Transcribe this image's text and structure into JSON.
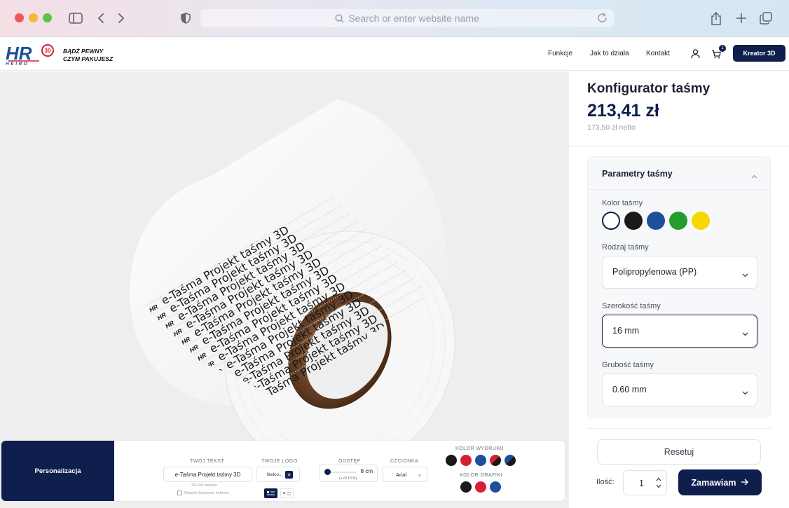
{
  "browser": {
    "address_placeholder": "Search or enter website name"
  },
  "header": {
    "brand": "HR",
    "brand_sub": "HEIRO",
    "brand_badge": "30",
    "tagline_1": "BĄDŹ PEWNY",
    "tagline_2": "CZYM PAKUJESZ",
    "nav": [
      "Funkcje",
      "Jak to działa",
      "Kontakt"
    ],
    "cart_count": "1",
    "cta_label": "Kreator 3D"
  },
  "viewer": {
    "tape_print_text": "e-Taśma Projekt taśmy 3D",
    "tape_logo_text": "HR"
  },
  "personalization": {
    "tab_label": "Personalizacja",
    "text_label": "TWÓJ TEKST",
    "text_value": "e-Taśma  Projekt taśmy 3D",
    "char_count": "25/100 znaków",
    "reverse_colors_label": "Odwróć kolejność kolorów",
    "logo_label": "TWOJE LOGO",
    "logo_file": "favico...",
    "spacing_label": "ODSTĘP",
    "spacing_value": "8 cm",
    "spacing_price": "(+22 PLN)",
    "font_label": "CZCIONKA",
    "font_value": "Arial",
    "print_color_label": "KOLOR WYDRUKU",
    "graphic_color_label": "KOLOR GRAFIKI",
    "print_colors": [
      "#1a1a1a",
      "#d51f35",
      "#1d4f9c",
      "#d51f35/#1a1a1a",
      "#1d4f9c/#1a1a1a"
    ],
    "graphic_colors": [
      "#1a1a1a",
      "#d51f35",
      "#1d4f9c"
    ]
  },
  "panel": {
    "title": "Konfigurator taśmy",
    "price": "213,41 zł",
    "price_net": "173,50 zł netto",
    "section_title": "Parametry taśmy",
    "color_label": "Kolor taśmy",
    "tape_colors": [
      "#ffffff",
      "#1a1a1a",
      "#1d4f9c",
      "#259c2e",
      "#f7d900"
    ],
    "selected_color": "#ffffff",
    "type_label": "Rodzaj taśmy",
    "type_value": "Polipropylenowa (PP)",
    "width_label": "Szerokość taśmy",
    "width_value": "16 mm",
    "thickness_label": "Grubość taśmy",
    "thickness_value": "0.60 mm",
    "reset_label": "Resetuj",
    "qty_label": "Ilość:",
    "qty_value": "1",
    "order_label": "Zamawiam"
  }
}
